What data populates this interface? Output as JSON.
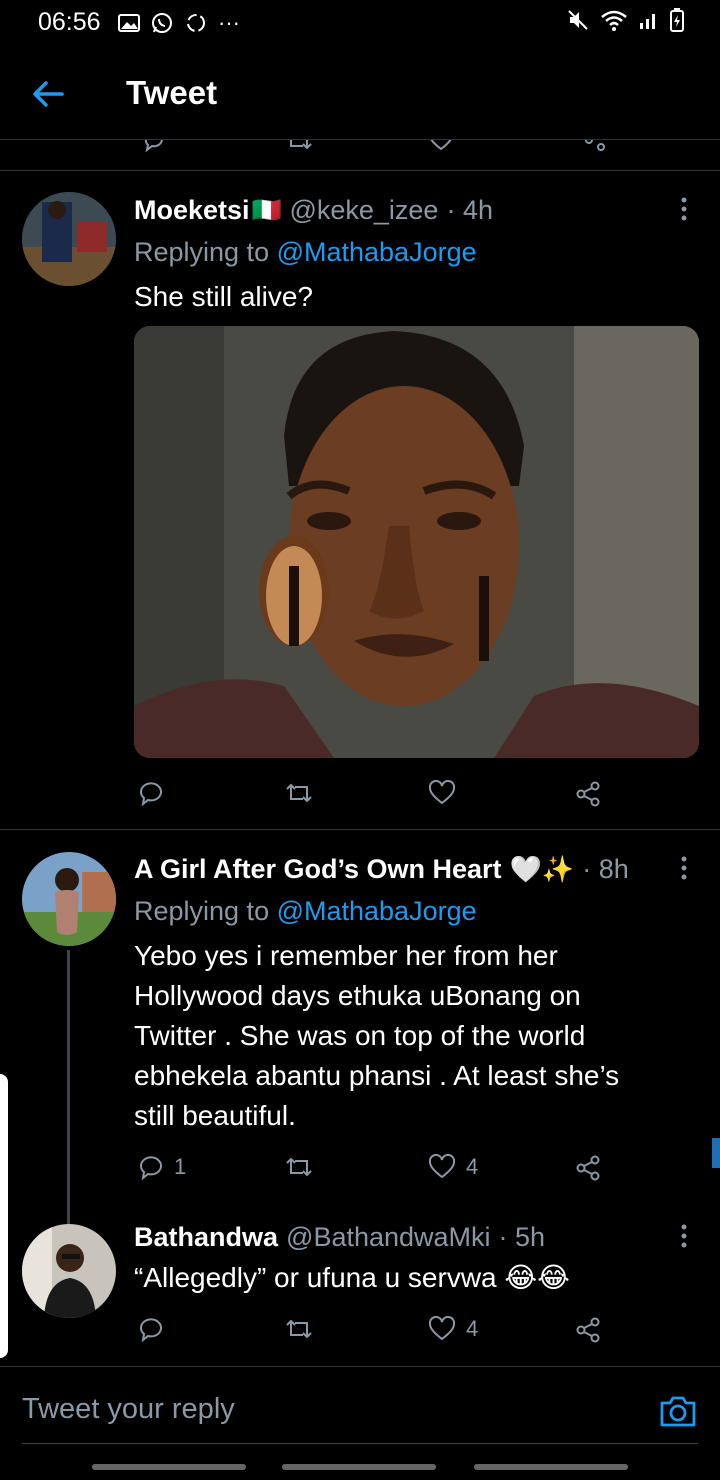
{
  "status": {
    "time": "06:56",
    "more": "···"
  },
  "header": {
    "title": "Tweet"
  },
  "tweets": [
    {
      "name": "Moeketsi",
      "flag": "🇮🇹",
      "handle": "@keke_izee",
      "time": "· 4h",
      "replying_prefix": "Replying to ",
      "replying_to": "@MathabaJorge",
      "text": "She still alive?",
      "reply_count": "",
      "retweet_count": "",
      "like_count": ""
    },
    {
      "name": "A Girl After God’s Own Heart",
      "emoji": "🤍✨",
      "handle": "",
      "time": "· 8h",
      "replying_prefix": "Replying to ",
      "replying_to": "@MathabaJorge",
      "text_lines": [
        "Yebo yes i remember her from her",
        "Hollywood days ethuka uBonang on",
        "Twitter . She was on top of the world",
        "ebhekela abantu phansi . At least she’s",
        "still beautiful."
      ],
      "reply_count": "1",
      "retweet_count": "",
      "like_count": "4"
    },
    {
      "name": "Bathandwa",
      "handle": "@BathandwaMki",
      "time": "· 5h",
      "text": "“Allegedly” or ufuna u servwa 😂😂",
      "reply_count": "",
      "retweet_count": "",
      "like_count": "4"
    }
  ],
  "composer": {
    "placeholder": "Tweet your reply"
  },
  "colors": {
    "accent": "#1d9bf0",
    "muted": "#8b98a5",
    "background": "#000000",
    "divider": "#2f3336"
  },
  "icons": [
    "back-arrow-icon",
    "reply-icon",
    "retweet-icon",
    "like-icon",
    "share-icon",
    "more-icon",
    "camera-icon"
  ]
}
